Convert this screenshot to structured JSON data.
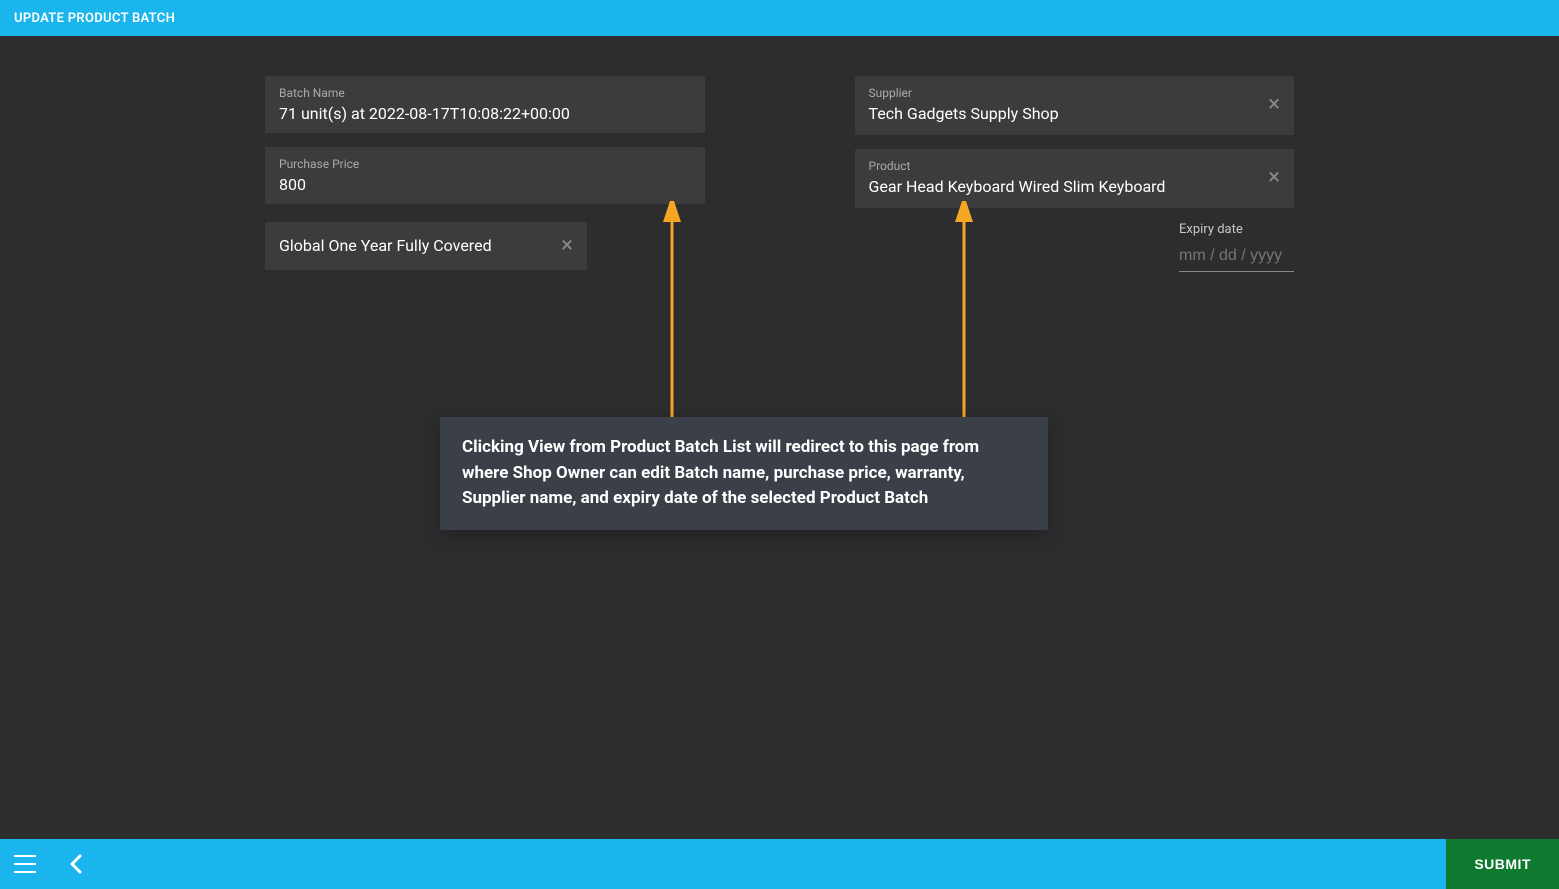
{
  "header": {
    "title": "UPDATE PRODUCT BATCH"
  },
  "form": {
    "batch_name": {
      "label": "Batch Name",
      "value": "71 unit(s) at 2022-08-17T10:08:22+00:00"
    },
    "purchase_price": {
      "label": "Purchase Price",
      "value": "800"
    },
    "warranty": {
      "value": "Global One Year Fully Covered"
    },
    "supplier": {
      "label": "Supplier",
      "value": "Tech Gadgets Supply Shop"
    },
    "product": {
      "label": "Product",
      "value": "Gear Head Keyboard Wired Slim Keyboard"
    },
    "expiry": {
      "label": "Expiry date",
      "placeholder": "mm / dd / yyyy"
    }
  },
  "annotation": {
    "text": "Clicking View from Product Batch List will redirect to this page from where Shop Owner can edit Batch name, purchase price, warranty, Supplier name, and expiry date of the selected Product Batch"
  },
  "footer": {
    "submit_label": "SUBMIT"
  }
}
